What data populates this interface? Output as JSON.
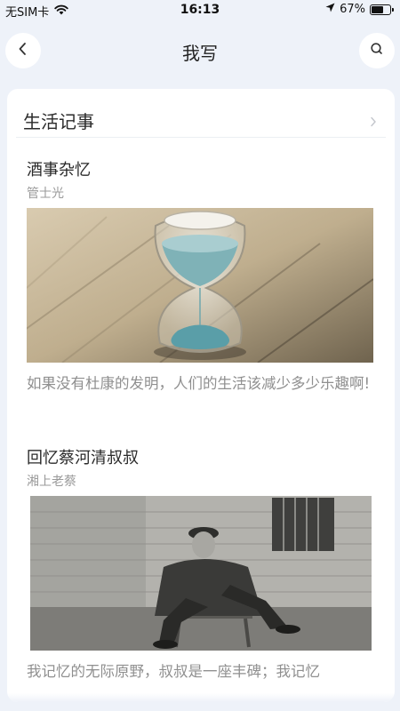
{
  "status_bar": {
    "carrier": "无SIM卡",
    "time": "16:13",
    "battery_percent": "67%",
    "battery_level": 0.67,
    "icons": [
      "wifi-icon",
      "location-arrow-icon",
      "battery-icon"
    ]
  },
  "nav": {
    "title": "我写",
    "back_icon": "chevron-left-icon",
    "search_icon": "search-icon"
  },
  "section": {
    "title": "生活记事",
    "chevron_icon": "chevron-right-icon"
  },
  "articles": [
    {
      "title": "酒事杂忆",
      "author": "管士光",
      "excerpt": "如果没有杜康的发明，人们的生活该减少多少乐趣啊!",
      "image_subject": "hourglass"
    },
    {
      "title": "回忆蔡河清叔叔",
      "author": "湘上老蔡",
      "excerpt": "我记忆的无际原野，叔叔是一座丰碑；我记忆",
      "image_subject": "old-man-sitting-photo"
    }
  ],
  "colors": {
    "page_background": "#eef2f9",
    "card_background": "#ffffff",
    "title_text": "#2a2a2a",
    "secondary_text": "#9a9a9a"
  }
}
